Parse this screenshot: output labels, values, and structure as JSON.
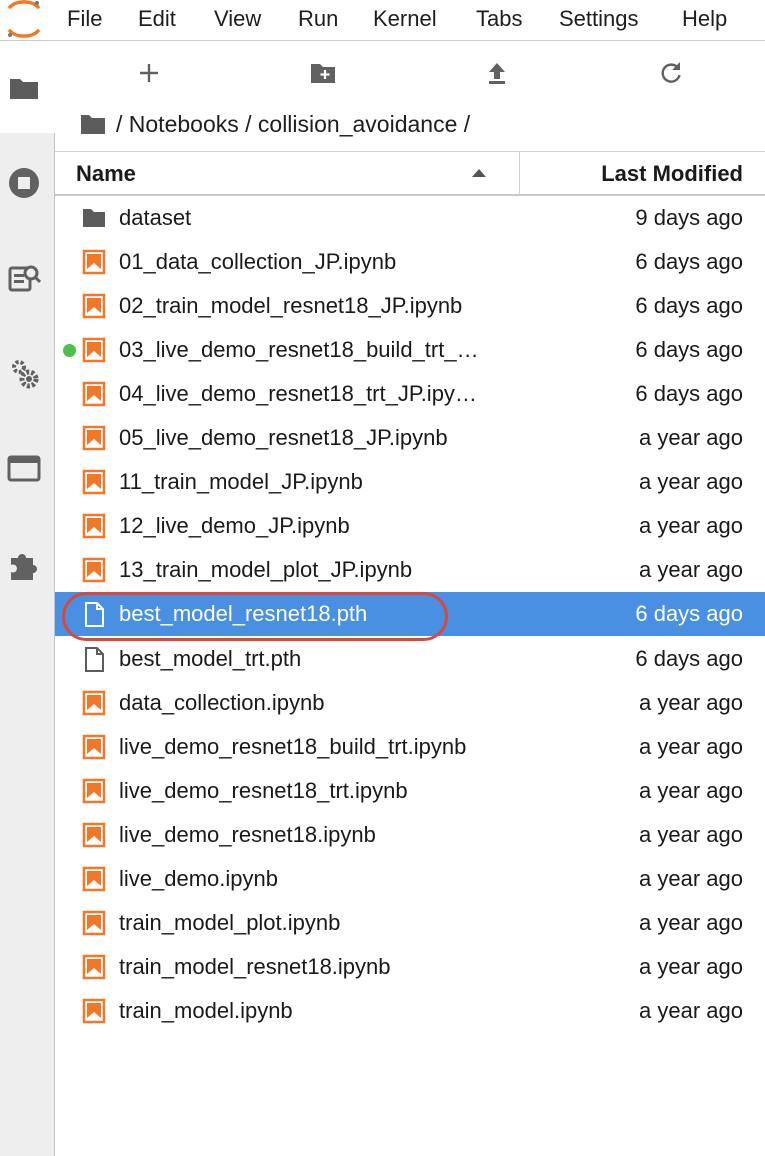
{
  "menu": [
    "File",
    "Edit",
    "View",
    "Run",
    "Kernel",
    "Tabs",
    "Settings",
    "Help"
  ],
  "sidebar": {
    "icons": [
      "folder-icon",
      "stop-circle-icon",
      "property-inspector-icon",
      "gears-icon",
      "tab-window-icon",
      "puzzle-extension-icon"
    ]
  },
  "toolbar": {
    "icons": [
      "new-launcher-plus-icon",
      "new-folder-icon",
      "upload-icon",
      "refresh-icon"
    ]
  },
  "breadcrumb": {
    "path": "/ Notebooks / collision_avoidance /"
  },
  "file_list": {
    "columns": {
      "name": "Name",
      "modified": "Last Modified"
    },
    "rows": [
      {
        "name": "dataset",
        "modified": "9 days ago",
        "type": "folder"
      },
      {
        "name": "01_data_collection_JP.ipynb",
        "modified": "6 days ago",
        "type": "notebook"
      },
      {
        "name": "02_train_model_resnet18_JP.ipynb",
        "modified": "6 days ago",
        "type": "notebook"
      },
      {
        "name": "03_live_demo_resnet18_build_trt_…",
        "modified": "6 days ago",
        "type": "notebook",
        "running": true
      },
      {
        "name": "04_live_demo_resnet18_trt_JP.ipy…",
        "modified": "6 days ago",
        "type": "notebook"
      },
      {
        "name": "05_live_demo_resnet18_JP.ipynb",
        "modified": "a year ago",
        "type": "notebook"
      },
      {
        "name": "11_train_model_JP.ipynb",
        "modified": "a year ago",
        "type": "notebook"
      },
      {
        "name": "12_live_demo_JP.ipynb",
        "modified": "a year ago",
        "type": "notebook"
      },
      {
        "name": "13_train_model_plot_JP.ipynb",
        "modified": "a year ago",
        "type": "notebook"
      },
      {
        "name": "best_model_resnet18.pth",
        "modified": "6 days ago",
        "type": "file",
        "selected": true
      },
      {
        "name": "best_model_trt.pth",
        "modified": "6 days ago",
        "type": "file"
      },
      {
        "name": "data_collection.ipynb",
        "modified": "a year ago",
        "type": "notebook"
      },
      {
        "name": "live_demo_resnet18_build_trt.ipynb",
        "modified": "a year ago",
        "type": "notebook"
      },
      {
        "name": "live_demo_resnet18_trt.ipynb",
        "modified": "a year ago",
        "type": "notebook"
      },
      {
        "name": "live_demo_resnet18.ipynb",
        "modified": "a year ago",
        "type": "notebook"
      },
      {
        "name": "live_demo.ipynb",
        "modified": "a year ago",
        "type": "notebook"
      },
      {
        "name": "train_model_plot.ipynb",
        "modified": "a year ago",
        "type": "notebook"
      },
      {
        "name": "train_model_resnet18.ipynb",
        "modified": "a year ago",
        "type": "notebook"
      },
      {
        "name": "train_model.ipynb",
        "modified": "a year ago",
        "type": "notebook"
      }
    ]
  },
  "colors": {
    "selected_row": "#4a90e2",
    "notebook_icon": "#f37726",
    "running_dot": "#4cc04a",
    "highlight_ring": "#d6493c",
    "sidebar_bg": "#eeeeee"
  }
}
